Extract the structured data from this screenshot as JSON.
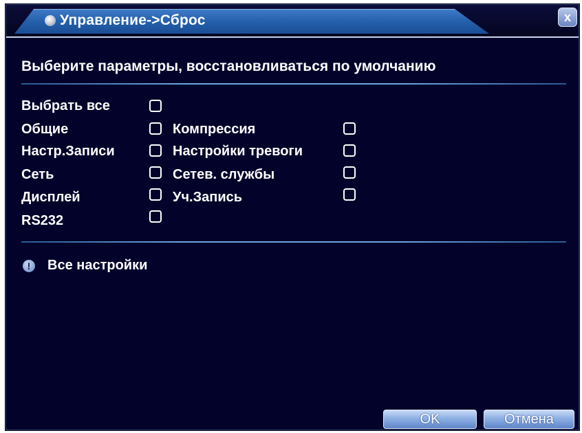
{
  "window": {
    "title": "Управление->Сброс",
    "close_symbol": "x"
  },
  "main": {
    "heading": "Выберите параметры, восстановливаться по умолчанию",
    "options": [
      {
        "label": "Выбрать все",
        "checked": false
      },
      {
        "label": "Общие",
        "checked": false
      },
      {
        "label": "Компрессия",
        "checked": false
      },
      {
        "label": "Настр.Записи",
        "checked": false
      },
      {
        "label": "Настройки тревоги",
        "checked": false
      },
      {
        "label": "Сеть",
        "checked": false
      },
      {
        "label": "Сетев. службы",
        "checked": false
      },
      {
        "label": "Дисплей",
        "checked": false
      },
      {
        "label": "Уч.Запись",
        "checked": false
      },
      {
        "label": "RS232",
        "checked": false
      }
    ],
    "info": {
      "icon": "exclamation-icon",
      "symbol": "!",
      "text": "Все настройки"
    }
  },
  "footer": {
    "ok_label": "OK",
    "cancel_label": "Отмена"
  },
  "colors": {
    "background": "#02022a",
    "title_tab": "#2561ad",
    "separator": "#6fa6e0",
    "button": "#8fb0e4"
  }
}
